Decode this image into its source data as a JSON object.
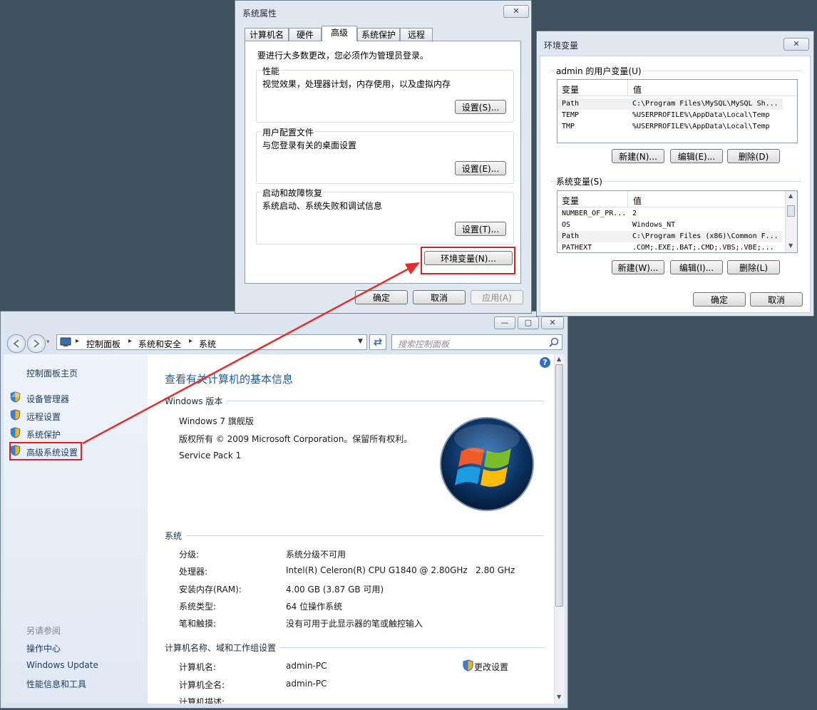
{
  "colors": {
    "desktop": "#3f515e",
    "link": "#1e5aa8",
    "highlight": "#e02020",
    "accent_title": "#1e5aa8"
  },
  "sysprops": {
    "title": "系统属性",
    "close": "✕",
    "tabs": [
      "计算机名",
      "硬件",
      "高级",
      "系统保护",
      "远程"
    ],
    "intro": "要进行大多数更改，您必须作为管理员登录。",
    "perf": {
      "label": "性能",
      "desc": "视觉效果，处理器计划，内存使用，以及虚拟内存",
      "btn": "设置(S)..."
    },
    "profile": {
      "label": "用户配置文件",
      "desc": "与您登录有关的桌面设置",
      "btn": "设置(E)..."
    },
    "startup": {
      "label": "启动和故障恢复",
      "desc": "系统启动、系统失败和调试信息",
      "btn": "设置(T)..."
    },
    "env_btn": "环境变量(N)...",
    "ok": "确定",
    "cancel": "取消",
    "apply": "应用(A)"
  },
  "envvars": {
    "title": "环境变量",
    "close": "✕",
    "user_label": "admin 的用户变量(U)",
    "col_var": "变量",
    "col_val": "值",
    "user_rows": [
      {
        "name": "Path",
        "value": "C:\\Program Files\\MySQL\\MySQL Sh..."
      },
      {
        "name": "TEMP",
        "value": "%USERPROFILE%\\AppData\\Local\\Temp"
      },
      {
        "name": "TMP",
        "value": "%USERPROFILE%\\AppData\\Local\\Temp"
      }
    ],
    "user_new": "新建(N)...",
    "user_edit": "编辑(E)...",
    "user_delete": "删除(D)",
    "sys_label": "系统变量(S)",
    "sys_rows": [
      {
        "name": "NUMBER_OF_PR...",
        "value": "2"
      },
      {
        "name": "OS",
        "value": "Windows_NT"
      },
      {
        "name": "Path",
        "value": "C:\\Program Files (x86)\\Common F..."
      },
      {
        "name": "PATHEXT",
        "value": ".COM;.EXE;.BAT;.CMD;.VBS;.VBE;..."
      }
    ],
    "sys_new": "新建(W)...",
    "sys_edit": "编辑(I)...",
    "sys_delete": "删除(L)",
    "ok": "确定",
    "cancel": "取消"
  },
  "system": {
    "window_btns": {
      "min": "—",
      "max": "▢",
      "close": "✕"
    },
    "breadcrumb": [
      "控制面板",
      "系统和安全",
      "系统"
    ],
    "search_placeholder": "搜索控制面板",
    "sidebar": {
      "home": "控制面板主页",
      "items": [
        "设备管理器",
        "远程设置",
        "系统保护",
        "高级系统设置"
      ],
      "see_also": "另请参阅",
      "links": [
        "操作中心",
        "Windows Update",
        "性能信息和工具"
      ]
    },
    "heading": "查看有关计算机的基本信息",
    "edition_hdr": "Windows 版本",
    "edition": "Windows 7 旗舰版",
    "copyright": "版权所有 © 2009 Microsoft Corporation。保留所有权利。",
    "sp": "Service Pack 1",
    "system_hdr": "系统",
    "specs": [
      {
        "label": "分级:",
        "value": "系统分级不可用",
        "link": true
      },
      {
        "label": "处理器:",
        "value": "Intel(R) Celeron(R) CPU G1840 @ 2.80GHz   2.80 GHz"
      },
      {
        "label": "安装内存(RAM):",
        "value": "4.00 GB (3.87 GB 可用)"
      },
      {
        "label": "系统类型:",
        "value": "64 位操作系统"
      },
      {
        "label": "笔和触摸:",
        "value": "没有可用于此显示器的笔或触控输入"
      }
    ],
    "comp_hdr": "计算机名称、域和工作组设置",
    "comp": [
      {
        "label": "计算机名:",
        "value": "admin-PC"
      },
      {
        "label": "计算机全名:",
        "value": "admin-PC"
      },
      {
        "label": "计算机描述:",
        "value": ""
      }
    ],
    "change_settings": "更改设置",
    "help": "?"
  }
}
